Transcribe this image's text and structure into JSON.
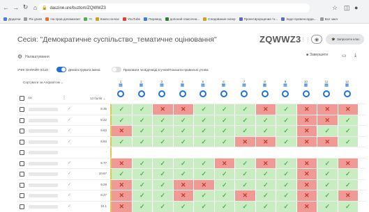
{
  "browser": {
    "url": "daszine.ure/buzlom/ZQWWZ3",
    "bookmarks": [
      {
        "label": "Додатки",
        "color": "#4a7bd9"
      },
      {
        "label": "Pix grass",
        "color": "#999999"
      },
      {
        "label": "На пров допомагает",
        "color": "#e26f2c"
      },
      {
        "label": "YI",
        "color": "#4caf50"
      },
      {
        "label": "Книги гончас",
        "color": "#d0a020"
      },
      {
        "label": "YouTube",
        "color": "#e53935"
      },
      {
        "label": "Перевод",
        "color": "#3b7bd9"
      },
      {
        "label": "допоной списочна...",
        "color": "#2e7d32"
      },
      {
        "label": "Следования гипер",
        "color": "#d0a020"
      },
      {
        "label": "Проектирорщение тз...",
        "color": "#5c6bc0"
      },
      {
        "label": "Заде превенсорда...",
        "color": "#5c6bc0"
      },
      {
        "label": "Все закл",
        "color": "#999999"
      }
    ]
  },
  "header": {
    "title": "Сесія: \"Демократичне суспільство_тематичне оцінювання\"",
    "code": "ZQWWZ3",
    "new_button": "Запросити клас",
    "settings_label": "Налаштування",
    "finish_label": "Завершити"
  },
  "options": {
    "label": "УЧНІ ОНЛАЙН 0/110",
    "toggle1": "Демонструвати імена",
    "toggle2": "Приховати чи відповіді в учнів/Показати правильні учням"
  },
  "grid": {
    "sort_label": "Сортувати за Алфавітом",
    "hdr_aa": "Аа",
    "points_label": "13 балів",
    "questions": [
      "1",
      "2",
      "3",
      "4",
      "5",
      "6",
      "7",
      "8",
      "9",
      "10",
      "11",
      "12"
    ],
    "rows": [
      {
        "score": "8.35",
        "cells": [
          "c",
          "c",
          "w",
          "w",
          "c",
          "c",
          "c",
          "w",
          "c",
          "w",
          "w",
          "w"
        ]
      },
      {
        "score": "8.22",
        "cells": [
          "c",
          "c",
          "c",
          "c",
          "c",
          "c",
          "c",
          "c",
          "c",
          "w",
          "w",
          "c"
        ]
      },
      {
        "score": "9.63",
        "cells": [
          "w",
          "c",
          "c",
          "c",
          "c",
          "c",
          "c",
          "c",
          "c",
          "w",
          "c",
          "c"
        ]
      },
      {
        "score": "8.93",
        "cells": [
          "c",
          "c",
          "c",
          "c",
          "c",
          "c",
          "w",
          "w",
          "c",
          "w",
          "w",
          "c"
        ]
      },
      {
        "score": "-",
        "cells": []
      },
      {
        "score": "8.77",
        "cells": [
          "w",
          "c",
          "c",
          "c",
          "c",
          "w",
          "c",
          "w",
          "c",
          "w",
          "c",
          "w"
        ]
      },
      {
        "score": "10.67",
        "cells": [
          "c",
          "c",
          "c",
          "c",
          "c",
          "c",
          "c",
          "c",
          "c",
          "w",
          "c",
          "c"
        ]
      },
      {
        "score": "9.28",
        "cells": [
          "w",
          "c",
          "c",
          "w",
          "w",
          "c",
          "c",
          "c",
          "c",
          "w",
          "c",
          "c"
        ]
      },
      {
        "score": "8.27",
        "cells": [
          "w",
          "c",
          "c",
          "w",
          "c",
          "c",
          "w",
          "c",
          "c",
          "w",
          "c",
          "w"
        ]
      },
      {
        "score": "10.1",
        "cells": [
          "w",
          "c",
          "c",
          "c",
          "c",
          "c",
          "c",
          "c",
          "c",
          "w",
          "c",
          "c"
        ]
      }
    ]
  }
}
